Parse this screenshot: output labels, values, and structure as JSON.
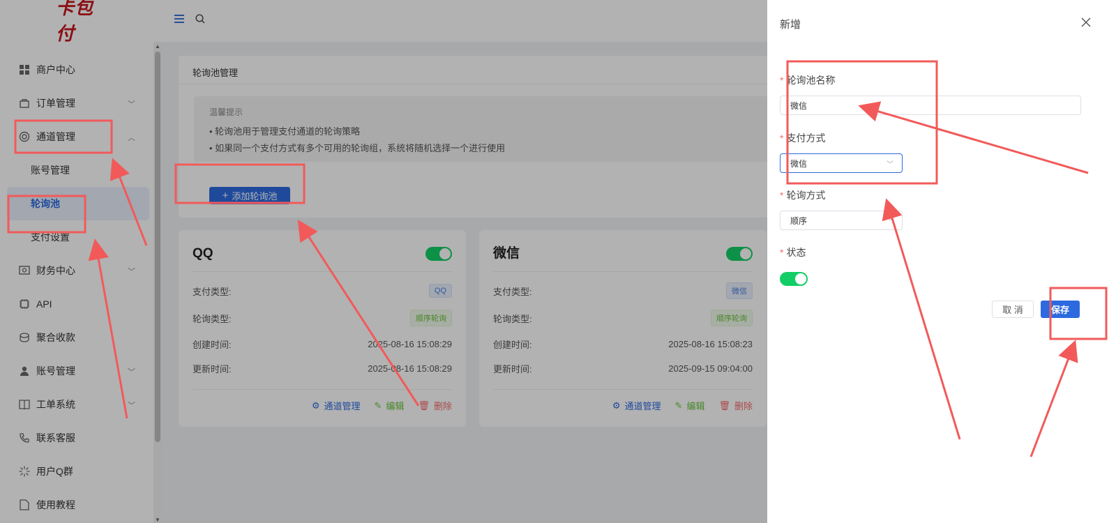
{
  "sidebar": {
    "logo": "卡包付",
    "menu": [
      {
        "label": "商户中心",
        "icon": "grid-icon"
      },
      {
        "label": "订单管理",
        "icon": "bag-icon",
        "chevron": "down"
      },
      {
        "label": "通道管理",
        "icon": "channel-icon",
        "chevron": "up"
      },
      {
        "label": "财务中心",
        "icon": "finance-icon",
        "chevron": "down"
      },
      {
        "label": "API",
        "icon": "chip-icon"
      },
      {
        "label": "聚合收款",
        "icon": "collect-icon"
      },
      {
        "label": "账号管理",
        "icon": "user-icon",
        "chevron": "down"
      },
      {
        "label": "工单系统",
        "icon": "book-icon",
        "chevron": "down"
      },
      {
        "label": "联系客服",
        "icon": "phone-icon"
      },
      {
        "label": "用户Q群",
        "icon": "loading-icon"
      },
      {
        "label": "使用教程",
        "icon": "doc-icon"
      }
    ],
    "submenu": [
      {
        "label": "账号管理",
        "active": false
      },
      {
        "label": "轮询池",
        "active": true
      },
      {
        "label": "支付设置",
        "active": false
      }
    ]
  },
  "panel": {
    "title": "轮询池管理",
    "tip_title": "温馨提示",
    "tip_lines": [
      "• 轮询池用于管理支付通道的轮询策略",
      "• 如果同一个支付方式有多个可用的轮询组，系统将随机选择一个进行使用"
    ],
    "add_button": "添加轮询池"
  },
  "cards": [
    {
      "title": "QQ",
      "enabled": true,
      "pay_type_label": "支付类型:",
      "pay_type": "QQ",
      "poll_type_label": "轮询类型:",
      "poll_type": "顺序轮询",
      "created_label": "创建时间:",
      "created": "2025-08-16 15:08:29",
      "updated_label": "更新时间:",
      "updated": "2025-08-16 15:08:29",
      "actions": {
        "channel": "通道管理",
        "edit": "编辑",
        "delete": "删除"
      }
    },
    {
      "title": "微信",
      "enabled": true,
      "pay_type_label": "支付类型:",
      "pay_type": "微信",
      "poll_type_label": "轮询类型:",
      "poll_type": "顺序轮询",
      "created_label": "创建时间:",
      "created": "2025-08-16 15:08:23",
      "updated_label": "更新时间:",
      "updated": "2025-09-15 09:04:00",
      "actions": {
        "channel": "通道管理",
        "edit": "编辑",
        "delete": "删除"
      }
    }
  ],
  "drawer": {
    "title": "新增",
    "name_label": "轮询池名称",
    "name_value": "微信",
    "pay_label": "支付方式",
    "pay_value": "微信",
    "poll_label": "轮询方式",
    "poll_value": "顺序",
    "status_label": "状态",
    "status_on": true,
    "cancel": "取 消",
    "save": "保存"
  },
  "colors": {
    "primary": "#2d6ae0",
    "success": "#13ce66",
    "danger": "#f56c6c",
    "annotation": "#f25a5a",
    "logo": "#c8161d"
  }
}
